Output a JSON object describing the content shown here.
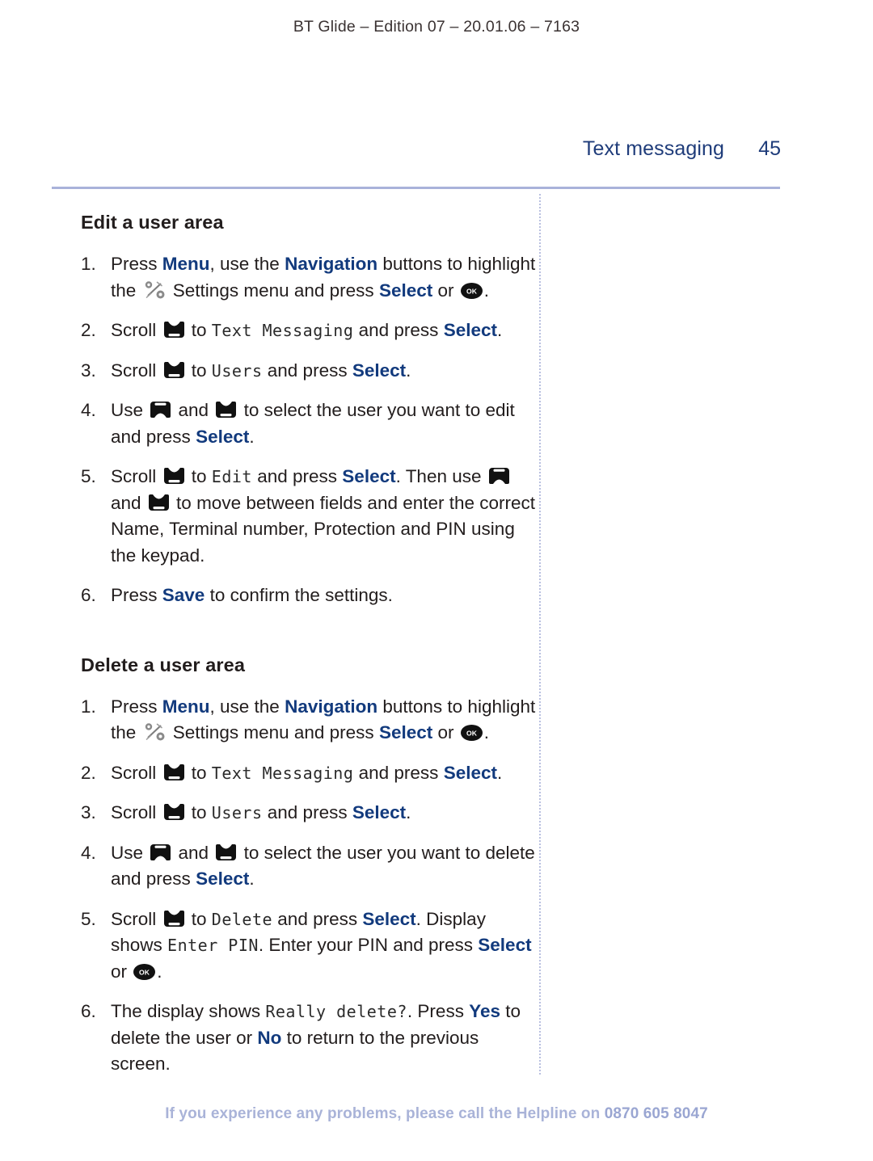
{
  "document": {
    "edition_line": "BT Glide – Edition 07 – 20.01.06 – 7163",
    "running_head": "Text messaging",
    "page_number": "45"
  },
  "colors": {
    "keyword_blue": "#123a7d",
    "runhead_blue": "#1f3c7a",
    "rule_lavender": "#a9b2da",
    "footer_lavender": "#a9b3d8",
    "body_text": "#221d1d"
  },
  "icons": {
    "settings": "settings-tools-icon",
    "ok": "ok-button-icon",
    "scroll_down": "scroll-down-key-icon",
    "scroll_up": "scroll-up-key-icon",
    "ok_label": "OK"
  },
  "sections": [
    {
      "title": "Edit a user area",
      "steps": [
        {
          "num": "1.",
          "parts": [
            {
              "t": "text",
              "v": "Press "
            },
            {
              "t": "kw",
              "v": "Menu"
            },
            {
              "t": "text",
              "v": ", use the "
            },
            {
              "t": "kw",
              "v": "Navigation"
            },
            {
              "t": "text",
              "v": " buttons to highlight the "
            },
            {
              "t": "icon",
              "v": "settings"
            },
            {
              "t": "text",
              "v": " Settings menu and press "
            },
            {
              "t": "kw",
              "v": "Select"
            },
            {
              "t": "text",
              "v": " or "
            },
            {
              "t": "icon",
              "v": "ok"
            },
            {
              "t": "text",
              "v": "."
            }
          ]
        },
        {
          "num": "2.",
          "parts": [
            {
              "t": "text",
              "v": "Scroll "
            },
            {
              "t": "icon",
              "v": "down"
            },
            {
              "t": "text",
              "v": " to "
            },
            {
              "t": "lcd",
              "v": "Text Messaging"
            },
            {
              "t": "text",
              "v": " and press "
            },
            {
              "t": "kw",
              "v": "Select"
            },
            {
              "t": "text",
              "v": "."
            }
          ]
        },
        {
          "num": "3.",
          "parts": [
            {
              "t": "text",
              "v": "Scroll "
            },
            {
              "t": "icon",
              "v": "down"
            },
            {
              "t": "text",
              "v": " to "
            },
            {
              "t": "lcd",
              "v": "Users"
            },
            {
              "t": "text",
              "v": " and press "
            },
            {
              "t": "kw",
              "v": "Select"
            },
            {
              "t": "text",
              "v": "."
            }
          ]
        },
        {
          "num": "4.",
          "parts": [
            {
              "t": "text",
              "v": "Use "
            },
            {
              "t": "icon",
              "v": "up"
            },
            {
              "t": "text",
              "v": " and "
            },
            {
              "t": "icon",
              "v": "down"
            },
            {
              "t": "text",
              "v": " to select the user you want to edit and press "
            },
            {
              "t": "kw",
              "v": "Select"
            },
            {
              "t": "text",
              "v": "."
            }
          ]
        },
        {
          "num": "5.",
          "parts": [
            {
              "t": "text",
              "v": "Scroll "
            },
            {
              "t": "icon",
              "v": "down"
            },
            {
              "t": "text",
              "v": " to "
            },
            {
              "t": "lcd",
              "v": "Edit"
            },
            {
              "t": "text",
              "v": " and press "
            },
            {
              "t": "kw",
              "v": "Select"
            },
            {
              "t": "text",
              "v": ". Then use "
            },
            {
              "t": "icon",
              "v": "up"
            },
            {
              "t": "text",
              "v": " and "
            },
            {
              "t": "icon",
              "v": "down"
            },
            {
              "t": "text",
              "v": " to move between fields and enter the correct Name, Terminal number, Protection and PIN using the keypad."
            }
          ]
        },
        {
          "num": "6.",
          "parts": [
            {
              "t": "text",
              "v": "Press "
            },
            {
              "t": "kw",
              "v": "Save"
            },
            {
              "t": "text",
              "v": " to confirm the settings."
            }
          ]
        }
      ]
    },
    {
      "title": "Delete a user area",
      "steps": [
        {
          "num": "1.",
          "parts": [
            {
              "t": "text",
              "v": "Press "
            },
            {
              "t": "kw",
              "v": "Menu"
            },
            {
              "t": "text",
              "v": ", use the "
            },
            {
              "t": "kw",
              "v": "Navigation"
            },
            {
              "t": "text",
              "v": " buttons to highlight the "
            },
            {
              "t": "icon",
              "v": "settings"
            },
            {
              "t": "text",
              "v": " Settings menu and press "
            },
            {
              "t": "kw",
              "v": "Select"
            },
            {
              "t": "text",
              "v": " or "
            },
            {
              "t": "icon",
              "v": "ok"
            },
            {
              "t": "text",
              "v": "."
            }
          ]
        },
        {
          "num": "2.",
          "parts": [
            {
              "t": "text",
              "v": "Scroll "
            },
            {
              "t": "icon",
              "v": "down"
            },
            {
              "t": "text",
              "v": " to "
            },
            {
              "t": "lcd",
              "v": "Text Messaging"
            },
            {
              "t": "text",
              "v": " and press "
            },
            {
              "t": "kw",
              "v": "Select"
            },
            {
              "t": "text",
              "v": "."
            }
          ]
        },
        {
          "num": "3.",
          "parts": [
            {
              "t": "text",
              "v": "Scroll "
            },
            {
              "t": "icon",
              "v": "down"
            },
            {
              "t": "text",
              "v": " to "
            },
            {
              "t": "lcd",
              "v": "Users"
            },
            {
              "t": "text",
              "v": " and press "
            },
            {
              "t": "kw",
              "v": "Select"
            },
            {
              "t": "text",
              "v": "."
            }
          ]
        },
        {
          "num": "4.",
          "parts": [
            {
              "t": "text",
              "v": "Use "
            },
            {
              "t": "icon",
              "v": "up"
            },
            {
              "t": "text",
              "v": " and "
            },
            {
              "t": "icon",
              "v": "down"
            },
            {
              "t": "text",
              "v": " to select the user you want to delete and press "
            },
            {
              "t": "kw",
              "v": "Select"
            },
            {
              "t": "text",
              "v": "."
            }
          ]
        },
        {
          "num": "5.",
          "parts": [
            {
              "t": "text",
              "v": "Scroll "
            },
            {
              "t": "icon",
              "v": "down"
            },
            {
              "t": "text",
              "v": " to "
            },
            {
              "t": "lcd",
              "v": "Delete"
            },
            {
              "t": "text",
              "v": " and press "
            },
            {
              "t": "kw",
              "v": "Select"
            },
            {
              "t": "text",
              "v": ". Display shows "
            },
            {
              "t": "lcd",
              "v": "Enter PIN"
            },
            {
              "t": "text",
              "v": ". Enter your PIN and press "
            },
            {
              "t": "kw",
              "v": "Select"
            },
            {
              "t": "text",
              "v": " or "
            },
            {
              "t": "icon",
              "v": "ok"
            },
            {
              "t": "text",
              "v": "."
            }
          ]
        },
        {
          "num": "6.",
          "parts": [
            {
              "t": "text",
              "v": "The display shows "
            },
            {
              "t": "lcd",
              "v": "Really delete?"
            },
            {
              "t": "text",
              "v": ". Press "
            },
            {
              "t": "kw",
              "v": "Yes"
            },
            {
              "t": "text",
              "v": " to delete the user or "
            },
            {
              "t": "kw",
              "v": "No"
            },
            {
              "t": "text",
              "v": " to return to the previous screen."
            }
          ]
        }
      ]
    }
  ],
  "footer": {
    "message": "If you experience any problems, please call the Helpline on ",
    "telephone": "0870 605 8047"
  }
}
